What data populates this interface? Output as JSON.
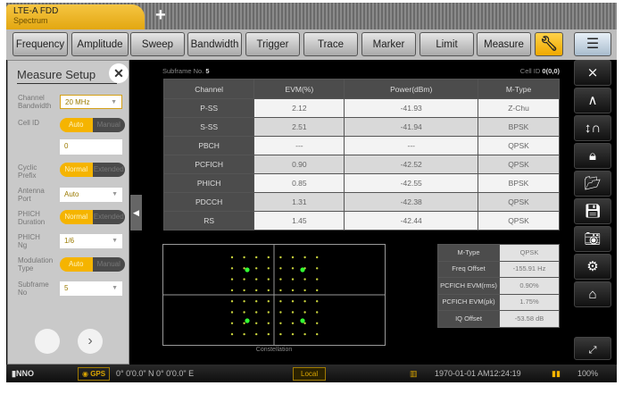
{
  "tab": {
    "title": "LTE-A FDD",
    "subtitle": "Spectrum",
    "add": "+"
  },
  "toolbar": [
    "Frequency",
    "Amplitude",
    "Sweep",
    "Bandwidth",
    "Trigger",
    "Trace",
    "Marker",
    "Limit",
    "Measure"
  ],
  "panel": {
    "title": "Measure Setup",
    "channel_bandwidth": {
      "label": "Channel Bandwidth",
      "value": "20 MHz"
    },
    "cell_id": {
      "label": "Cell ID",
      "on": "Auto",
      "off": "Manual",
      "value": "0"
    },
    "cyclic_prefix": {
      "label": "Cyclic Prefix",
      "on": "Normal",
      "off": "Extended"
    },
    "antenna_port": {
      "label": "Antenna Port",
      "value": "Auto"
    },
    "phich_duration": {
      "label": "PHICH Duration",
      "on": "Normal",
      "off": "Extended"
    },
    "phich_ng": {
      "label": "PHICH Ng",
      "value": "1/6"
    },
    "modulation_type": {
      "label": "Modulation Type",
      "on": "Auto",
      "off": "Manual"
    },
    "subframe_no": {
      "label": "Subframe No",
      "value": "5"
    }
  },
  "header": {
    "subframe_label": "Subframe No.",
    "subframe": "5",
    "cell_label": "Cell ID",
    "cell": "0(0,0)"
  },
  "table": {
    "columns": [
      "Channel",
      "EVM(%)",
      "Power(dBm)",
      "M-Type"
    ],
    "rows": [
      [
        "P-SS",
        "2.12",
        "-41.93",
        "Z-Chu"
      ],
      [
        "S-SS",
        "2.51",
        "-41.94",
        "BPSK"
      ],
      [
        "PBCH",
        "---",
        "---",
        "QPSK"
      ],
      [
        "PCFICH",
        "0.90",
        "-42.52",
        "QPSK"
      ],
      [
        "PHICH",
        "0.85",
        "-42.55",
        "BPSK"
      ],
      [
        "PDCCH",
        "1.31",
        "-42.38",
        "QPSK"
      ],
      [
        "RS",
        "1.45",
        "-42.44",
        "QPSK"
      ]
    ]
  },
  "constellation": {
    "label": "Constellation"
  },
  "info": [
    [
      "M-Type",
      "QPSK"
    ],
    [
      "Freq Offset",
      "-155.91 Hz"
    ],
    [
      "PCFICH EVM(rms)",
      "0.90%"
    ],
    [
      "PCFICH EVM(pk)",
      "1.75%"
    ],
    [
      "IQ Offset",
      "-53.58 dB"
    ]
  ],
  "status": {
    "gps": "GPS",
    "coords": "0° 0'0.0\" N 0° 0'0.0\" E",
    "mode": "Local",
    "datetime": "1970-01-01  AM12:24:19",
    "battery": "100%"
  },
  "colors": {
    "accent": "#f5b400",
    "qpsk_point": "#33ff33",
    "grid_point": "#c8d23c"
  }
}
